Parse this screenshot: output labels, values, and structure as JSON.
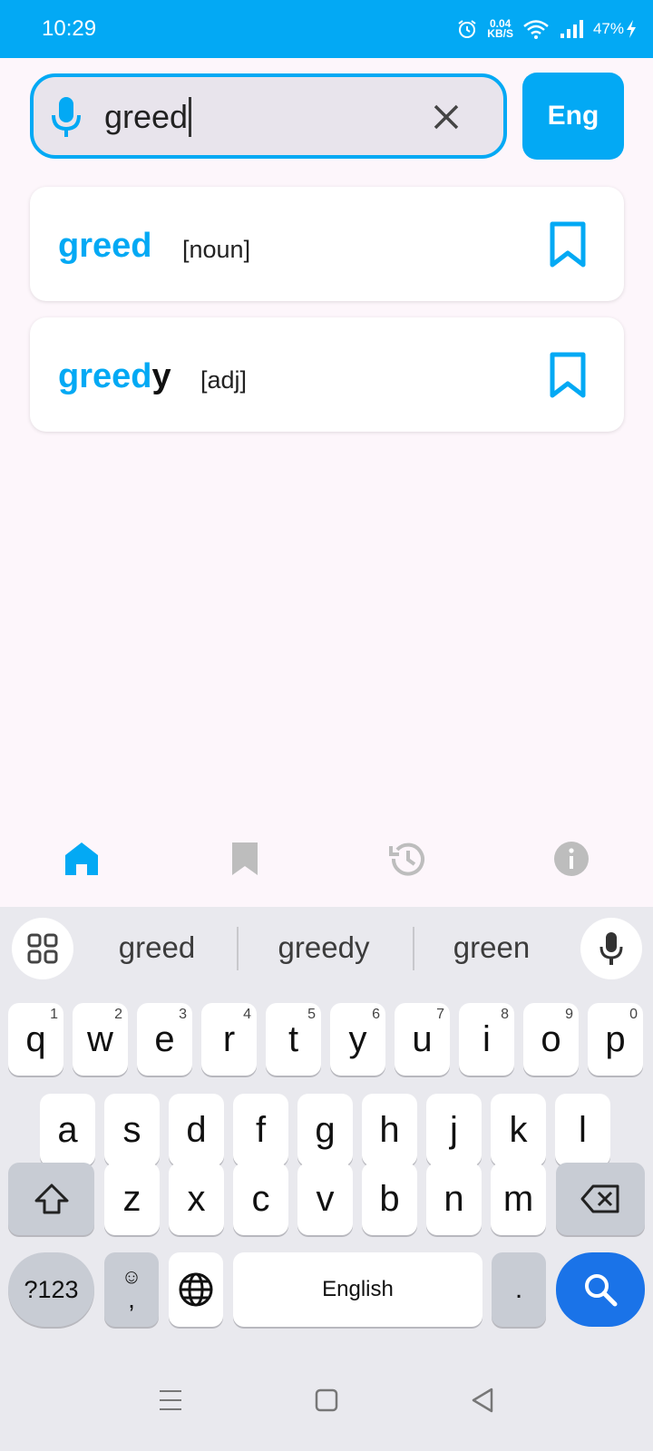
{
  "status_bar": {
    "time": "10:29",
    "net_speed_value": "0.04",
    "net_speed_unit": "KB/S",
    "battery": "47%"
  },
  "search": {
    "query": "greed",
    "lang_button": "Eng"
  },
  "results": [
    {
      "match": "greed",
      "rest": "",
      "pos": "[noun]"
    },
    {
      "match": "greed",
      "rest": "y",
      "pos": "[adj]"
    }
  ],
  "bottom_nav": {
    "items": [
      "home",
      "bookmarks",
      "history",
      "info"
    ],
    "active": "home"
  },
  "keyboard": {
    "suggestions": [
      "greed",
      "greedy",
      "green"
    ],
    "row1": [
      {
        "k": "q",
        "h": "1"
      },
      {
        "k": "w",
        "h": "2"
      },
      {
        "k": "e",
        "h": "3"
      },
      {
        "k": "r",
        "h": "4"
      },
      {
        "k": "t",
        "h": "5"
      },
      {
        "k": "y",
        "h": "6"
      },
      {
        "k": "u",
        "h": "7"
      },
      {
        "k": "i",
        "h": "8"
      },
      {
        "k": "o",
        "h": "9"
      },
      {
        "k": "p",
        "h": "0"
      }
    ],
    "row2": [
      "a",
      "s",
      "d",
      "f",
      "g",
      "h",
      "j",
      "k",
      "l"
    ],
    "row3": [
      "z",
      "x",
      "c",
      "v",
      "b",
      "n",
      "m"
    ],
    "symbols_key": "?123",
    "comma_key": ",",
    "space_label": "English",
    "period_key": "."
  },
  "colors": {
    "accent": "#03a9f4",
    "search_key": "#1a73e8",
    "inactive_icon": "#bdbdbd"
  }
}
